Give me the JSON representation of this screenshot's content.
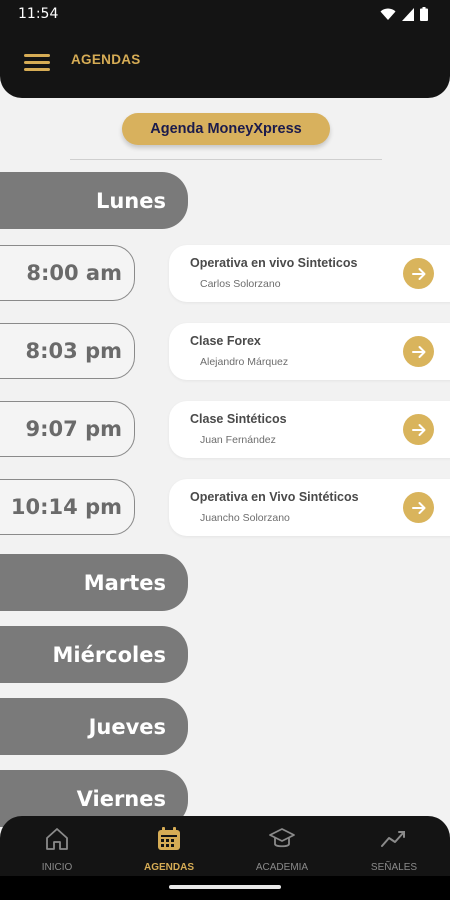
{
  "status_bar": {
    "time": "11:54"
  },
  "header": {
    "title": "AGENDAS"
  },
  "agenda_selector": {
    "label": "Agenda MoneyXpress"
  },
  "days": [
    {
      "label": "Lunes"
    },
    {
      "label": "Martes"
    },
    {
      "label": "Miércoles"
    },
    {
      "label": "Jueves"
    },
    {
      "label": "Viernes"
    }
  ],
  "events": [
    {
      "time": "8:00 am",
      "title": "Operativa en vivo Sinteticos",
      "host": "Carlos Solorzano"
    },
    {
      "time": "8:03 pm",
      "title": "Clase Forex",
      "host": "Alejandro Márquez"
    },
    {
      "time": "9:07 pm",
      "title": "Clase Sintéticos",
      "host": "Juan Fernández"
    },
    {
      "time": "10:14 pm",
      "title": "Operativa en Vivo Sintéticos",
      "host": "Juancho Solorzano"
    }
  ],
  "bottom_nav": {
    "items": [
      {
        "label": "INICIO",
        "icon": "home-icon"
      },
      {
        "label": "AGENDAS",
        "icon": "calendar-icon"
      },
      {
        "label": "ACADEMIA",
        "icon": "graduation-cap-icon"
      },
      {
        "label": "SEÑALES",
        "icon": "trend-icon"
      }
    ],
    "active": "AGENDAS"
  },
  "colors": {
    "accent": "#d6ac55",
    "dark": "#141414",
    "day_tab": "#7a7a7a",
    "background": "#f2f2f2"
  }
}
